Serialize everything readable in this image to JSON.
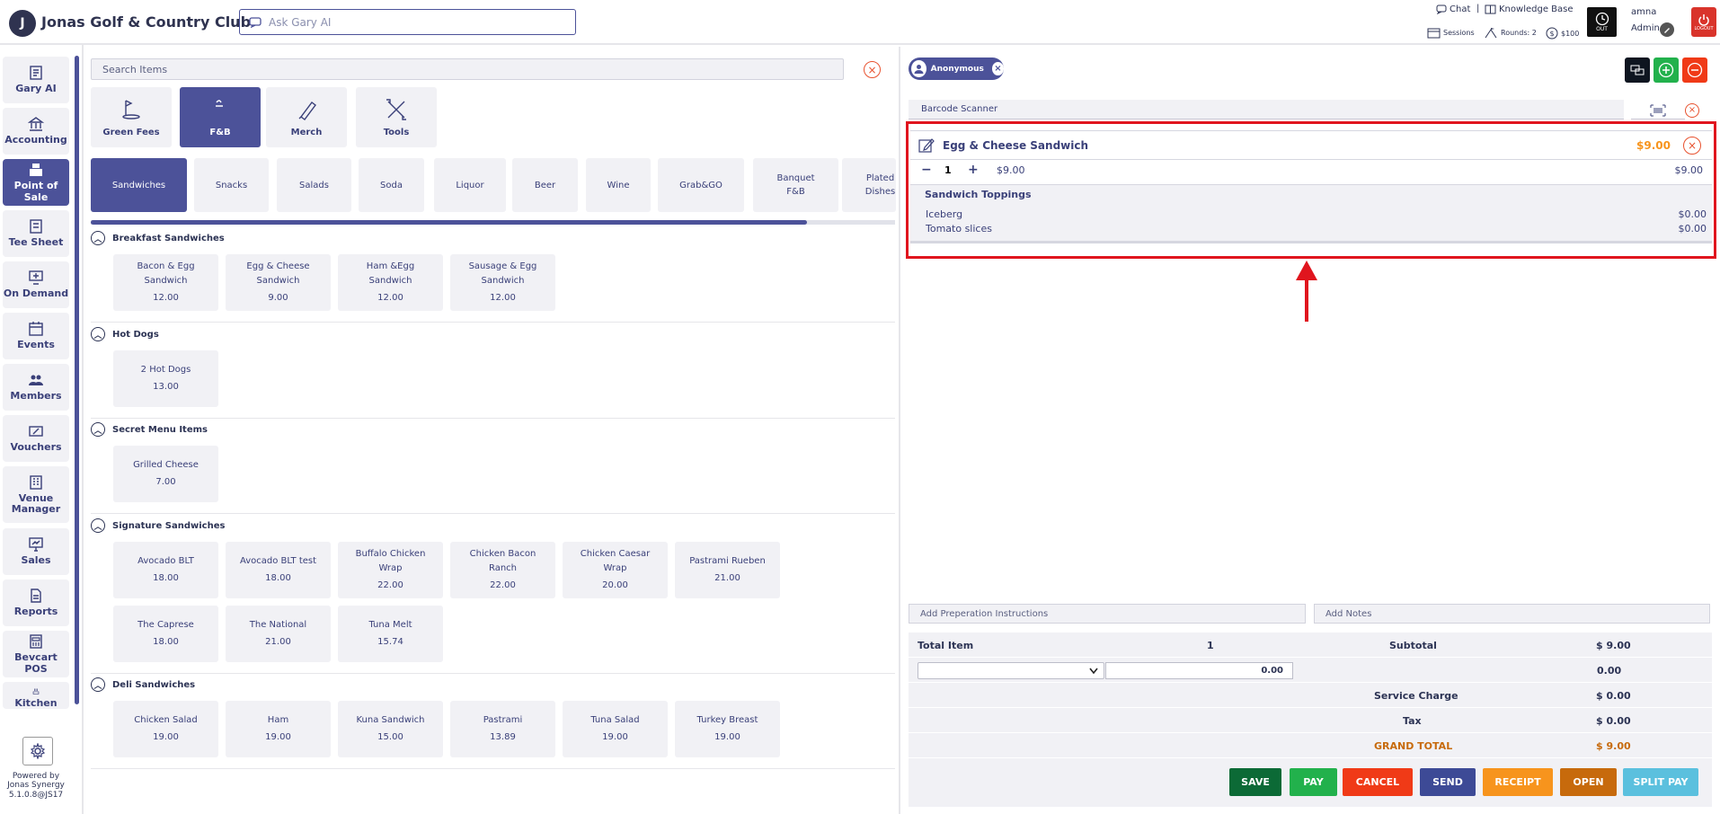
{
  "header": {
    "logo_text": "J",
    "club_name": "Jonas Golf & Country Club",
    "ask_placeholder": "Ask Gary AI",
    "chat_label": "Chat",
    "knowledge_base_label": "Knowledge Base",
    "sessions_label": "Sessions",
    "rounds_label": "Rounds: 2",
    "cash_label": "$100",
    "clock_label": "OUT",
    "user_name": "amna",
    "user_role": "Admin",
    "logout_label": "LOGOUT"
  },
  "sidebar": {
    "items": [
      {
        "label": "Gary AI",
        "icon": "gary-ai-icon"
      },
      {
        "label": "Accounting",
        "icon": "bank-icon"
      },
      {
        "label": "Point of Sale",
        "icon": "register-icon",
        "active": true
      },
      {
        "label": "Tee Sheet",
        "icon": "sheet-icon"
      },
      {
        "label": "On Demand",
        "icon": "monitor-plus-icon"
      },
      {
        "label": "Events",
        "icon": "calendar-icon"
      },
      {
        "label": "Members",
        "icon": "members-icon"
      },
      {
        "label": "Vouchers",
        "icon": "voucher-icon"
      },
      {
        "label": "Venue Manager",
        "icon": "building-icon"
      },
      {
        "label": "Sales",
        "icon": "sales-icon"
      },
      {
        "label": "Reports",
        "icon": "report-icon"
      },
      {
        "label": "Bevcart POS",
        "icon": "bevcart-icon"
      },
      {
        "label": "Kitchen",
        "icon": "kitchen-icon"
      }
    ],
    "powered_line1": "Powered by",
    "powered_line2": "Jonas Synergy",
    "version": "5.1.0.8@JS17"
  },
  "items_panel": {
    "search_placeholder": "Search Items",
    "categories": [
      {
        "label": "Green Fees",
        "icon": "golf-icon"
      },
      {
        "label": "F&B",
        "icon": "food-icon",
        "active": true
      },
      {
        "label": "Merch",
        "icon": "merch-icon"
      },
      {
        "label": "Tools",
        "icon": "tools-icon"
      }
    ],
    "sub_tabs": [
      {
        "label": "Sandwiches",
        "active": true
      },
      {
        "label": "Snacks"
      },
      {
        "label": "Salads"
      },
      {
        "label": "Soda"
      },
      {
        "label": "Liquor"
      },
      {
        "label": "Beer"
      },
      {
        "label": "Wine"
      },
      {
        "label": "Grab&GO"
      },
      {
        "label": "Banquet F&B"
      },
      {
        "label": "Plated Dishes"
      }
    ],
    "scroll_progress": 0.89,
    "sections": [
      {
        "title": "Breakfast Sandwiches",
        "items": [
          {
            "name": "Bacon & Egg Sandwich",
            "price": "12.00"
          },
          {
            "name": "Egg & Cheese Sandwich",
            "price": "9.00"
          },
          {
            "name": "Ham &Egg Sandwich",
            "price": "12.00"
          },
          {
            "name": "Sausage & Egg Sandwich",
            "price": "12.00"
          }
        ]
      },
      {
        "title": "Hot Dogs",
        "items": [
          {
            "name": "2 Hot Dogs",
            "price": "13.00"
          }
        ]
      },
      {
        "title": "Secret Menu Items",
        "items": [
          {
            "name": "Grilled Cheese",
            "price": "7.00"
          }
        ]
      },
      {
        "title": "Signature Sandwiches",
        "items": [
          {
            "name": "Avocado BLT",
            "price": "18.00"
          },
          {
            "name": "Avocado BLT test",
            "price": "18.00"
          },
          {
            "name": "Buffalo Chicken Wrap",
            "price": "22.00"
          },
          {
            "name": "Chicken Bacon Ranch",
            "price": "22.00"
          },
          {
            "name": "Chicken Caesar Wrap",
            "price": "20.00"
          },
          {
            "name": "Pastrami Rueben",
            "price": "21.00"
          },
          {
            "name": "The Caprese",
            "price": "18.00"
          },
          {
            "name": "The National",
            "price": "21.00"
          },
          {
            "name": "Tuna Melt",
            "price": "15.74"
          }
        ]
      },
      {
        "title": "Deli Sandwiches",
        "items": [
          {
            "name": "Chicken Salad",
            "price": "19.00"
          },
          {
            "name": "Ham",
            "price": "19.00"
          },
          {
            "name": "Kuna Sandwich",
            "price": "15.00"
          },
          {
            "name": "Pastrami",
            "price": "13.89"
          },
          {
            "name": "Tuna Salad",
            "price": "19.00"
          },
          {
            "name": "Turkey Breast",
            "price": "19.00"
          }
        ]
      }
    ]
  },
  "order": {
    "customer": "Anonymous",
    "barcode_placeholder": "Barcode Scanner",
    "line_item": {
      "name": "Egg & Cheese Sandwich",
      "total": "$9.00",
      "qty": "1",
      "unit_price": "$9.00",
      "line_total": "$9.00",
      "modifier_group": "Sandwich Toppings",
      "modifiers": [
        {
          "name": "Iceberg",
          "price": "$0.00"
        },
        {
          "name": "Tomato slices",
          "price": "$0.00"
        }
      ]
    },
    "prep_placeholder": "Add Preperation Instructions",
    "notes_placeholder": "Add Notes",
    "totals": {
      "total_item_label": "Total Item",
      "total_item_value": "1",
      "subtotal_label": "Subtotal",
      "subtotal_value": "$ 9.00",
      "discount_input": "0.00",
      "discount_value": "0.00",
      "service_label": "Service Charge",
      "service_value": "$ 0.00",
      "tax_label": "Tax",
      "tax_value": "$ 0.00",
      "grand_label": "GRAND TOTAL",
      "grand_value": "$ 9.00"
    },
    "actions": [
      {
        "label": "SAVE",
        "color": "#0c6a36"
      },
      {
        "label": "PAY",
        "color": "#22b14c"
      },
      {
        "label": "CANCEL",
        "color": "#f03a17"
      },
      {
        "label": "SEND",
        "color": "#3d4a96"
      },
      {
        "label": "RECEIPT",
        "color": "#f7941d"
      },
      {
        "label": "OPEN",
        "color": "#c76a0c"
      },
      {
        "label": "SPLIT PAY",
        "color": "#5bc0de"
      }
    ]
  }
}
